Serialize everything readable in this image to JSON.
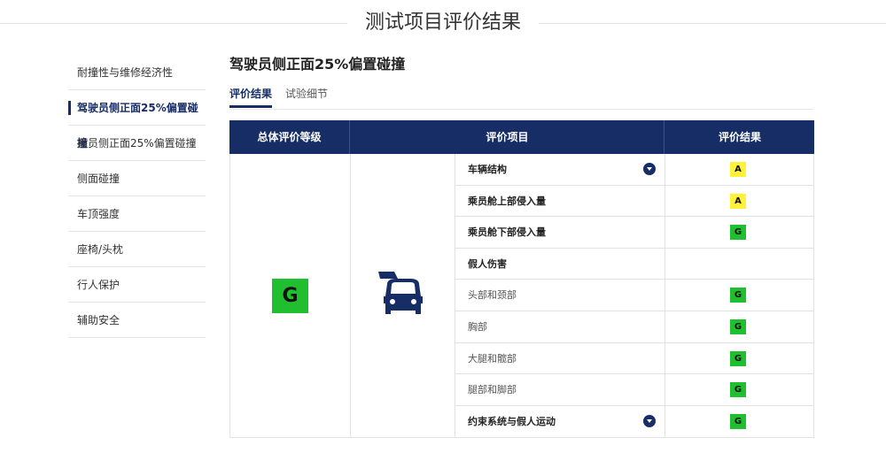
{
  "page": {
    "title": "测试项目评价结果"
  },
  "sidebar": {
    "items": [
      {
        "label": "耐撞性与维修经济性",
        "active": false
      },
      {
        "label": "驾驶员侧正面25%偏置碰撞",
        "active": true
      },
      {
        "label": "乘员侧正面25%偏置碰撞",
        "active": false
      },
      {
        "label": "侧面碰撞",
        "active": false
      },
      {
        "label": "车顶强度",
        "active": false
      },
      {
        "label": "座椅/头枕",
        "active": false
      },
      {
        "label": "行人保护",
        "active": false
      },
      {
        "label": "辅助安全",
        "active": false
      }
    ]
  },
  "section": {
    "title": "驾驶员侧正面25%偏置碰撞",
    "tabs": [
      {
        "label": "评价结果",
        "active": true
      },
      {
        "label": "试验细节",
        "active": false
      }
    ]
  },
  "table": {
    "headers": {
      "overall": "总体评价等级",
      "item": "评价项目",
      "result": "评价结果"
    },
    "overall_grade": "G",
    "rows": [
      {
        "label": "车辆结构",
        "bold": true,
        "expandable": true,
        "grade": "A"
      },
      {
        "label": "乘员舱上部侵入量",
        "bold": true,
        "expandable": false,
        "grade": "A"
      },
      {
        "label": "乘员舱下部侵入量",
        "bold": true,
        "expandable": false,
        "grade": "G"
      },
      {
        "label": "假人伤害",
        "bold": true,
        "expandable": false,
        "grade": ""
      },
      {
        "label": "头部和颈部",
        "bold": false,
        "expandable": false,
        "grade": "G"
      },
      {
        "label": "胸部",
        "bold": false,
        "expandable": false,
        "grade": "G"
      },
      {
        "label": "大腿和髋部",
        "bold": false,
        "expandable": false,
        "grade": "G"
      },
      {
        "label": "腿部和脚部",
        "bold": false,
        "expandable": false,
        "grade": "G"
      },
      {
        "label": "约束系统与假人运动",
        "bold": true,
        "expandable": true,
        "grade": "G"
      }
    ]
  },
  "colors": {
    "brand_navy": "#172d66",
    "grade_good": "#1fbf2f",
    "grade_acceptable": "#fff238"
  },
  "icons": {
    "chevron": "chevron-down-icon",
    "crash": "frontal-crash-icon"
  }
}
